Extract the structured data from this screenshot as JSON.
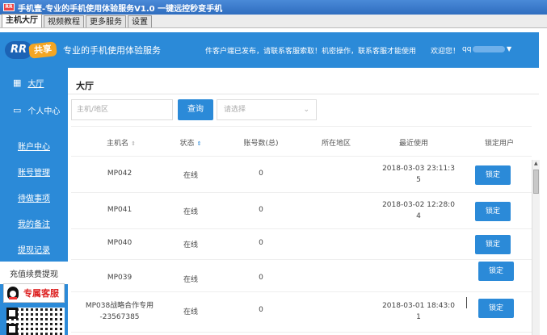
{
  "window": {
    "title": "手机壹-专业的手机使用体验服务V1.0 一键远控秒变手机",
    "app_icon_text": "RR"
  },
  "menu": {
    "tabs": [
      "主机大厅",
      "视频教程",
      "更多服务",
      "设置"
    ]
  },
  "header": {
    "logo_main": "RR",
    "logo_sub": "共享",
    "slogan": "专业的手机使用体验服务",
    "marquee": "件客户端已发布，请联系客服索取！机密操作，联系客服才能使用",
    "welcome": "欢迎您！",
    "user": "qq",
    "accent_color": "#2b8ad8"
  },
  "sidebar": {
    "main_items": [
      {
        "label": "大厅",
        "icon": "grid-icon"
      },
      {
        "label": "个人中心",
        "icon": "document-icon"
      }
    ],
    "sub_items": [
      "账户中心",
      "账号管理",
      "待做事项",
      "我的备注",
      "提现记录"
    ],
    "recharge": "充值续费提现",
    "qq_service": "专属客服"
  },
  "content": {
    "title": "大厅",
    "search_placeholder": "主机/地区",
    "query_button": "查询",
    "select_placeholder": "请选择"
  },
  "table": {
    "headers": [
      "主机名",
      "状态",
      "账号数(总)",
      "所在地区",
      "最近使用",
      "锁定用户"
    ],
    "rows": [
      {
        "host": "MP042",
        "host2": "",
        "status": "在线",
        "accounts": "0",
        "region": "",
        "last1": "2018-03-03 23:11:3",
        "last2": "5",
        "lock": "锁定"
      },
      {
        "host": "MP041",
        "host2": "",
        "status": "在线",
        "accounts": "0",
        "region": "",
        "last1": "2018-03-02 12:28:0",
        "last2": "4",
        "lock": "锁定"
      },
      {
        "host": "MP040",
        "host2": "",
        "status": "在线",
        "accounts": "0",
        "region": "",
        "last1": "",
        "last2": "",
        "lock": "锁定"
      },
      {
        "host": "MP039",
        "host2": "",
        "status": "在线",
        "accounts": "0",
        "region": "",
        "last1": "",
        "last2": "",
        "lock": "锁定"
      },
      {
        "host": "MP038战略合作专用",
        "host2": "-23567385",
        "status": "在线",
        "accounts": "0",
        "region": "",
        "last1": "2018-03-01 18:43:0",
        "last2": "1",
        "lock": "锁定"
      }
    ]
  }
}
